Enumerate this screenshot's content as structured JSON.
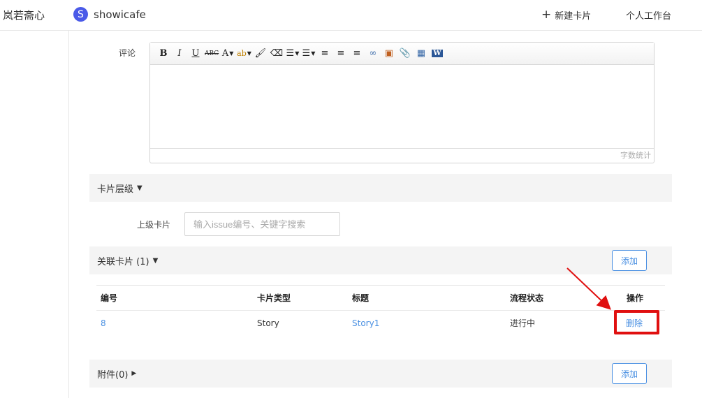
{
  "header": {
    "user_name": "岚若斋心",
    "project_logo_letter": "S",
    "project_name": "showicafe",
    "new_card_label": "新建卡片",
    "workspace_label": "个人工作台"
  },
  "comment": {
    "label": "评论",
    "toolbar": [
      {
        "name": "bold-icon",
        "glyph": "B"
      },
      {
        "name": "italic-icon",
        "glyph": "I"
      },
      {
        "name": "underline-icon",
        "glyph": "U"
      },
      {
        "name": "strikethrough-icon",
        "glyph": "ABC"
      },
      {
        "name": "font-color-icon",
        "glyph": "A"
      },
      {
        "name": "highlight-color-icon",
        "glyph": "ab"
      },
      {
        "name": "format-painter-icon",
        "glyph": "🖌"
      },
      {
        "name": "eraser-icon",
        "glyph": "⌫"
      },
      {
        "name": "bullet-list-icon",
        "glyph": "☰"
      },
      {
        "name": "numbered-list-icon",
        "glyph": "☰"
      },
      {
        "name": "align-left-icon",
        "glyph": "≡"
      },
      {
        "name": "align-center-icon",
        "glyph": "≡"
      },
      {
        "name": "align-right-icon",
        "glyph": "≡"
      },
      {
        "name": "link-icon",
        "glyph": "∞"
      },
      {
        "name": "image-icon",
        "glyph": "▣"
      },
      {
        "name": "attachment-icon",
        "glyph": "📎"
      },
      {
        "name": "table-icon",
        "glyph": "▦"
      },
      {
        "name": "word-icon",
        "glyph": "W"
      }
    ],
    "word_count_label": "字数统计"
  },
  "card_hierarchy": {
    "title": "卡片层级",
    "parent_label": "上级卡片",
    "parent_placeholder": "输入issue编号、关键字搜索"
  },
  "related_cards": {
    "title": "关联卡片 (1)",
    "add_label": "添加",
    "columns": [
      "编号",
      "卡片类型",
      "标题",
      "流程状态",
      "操作"
    ],
    "rows": [
      {
        "id": "8",
        "type": "Story",
        "title": "Story1",
        "status": "进行中",
        "action": "删除"
      }
    ]
  },
  "attachments": {
    "title": "附件(0)",
    "add_label": "添加"
  },
  "colors": {
    "accent": "#4a90e2",
    "annotation": "#e01010",
    "project_logo": "#4a5ae8"
  }
}
